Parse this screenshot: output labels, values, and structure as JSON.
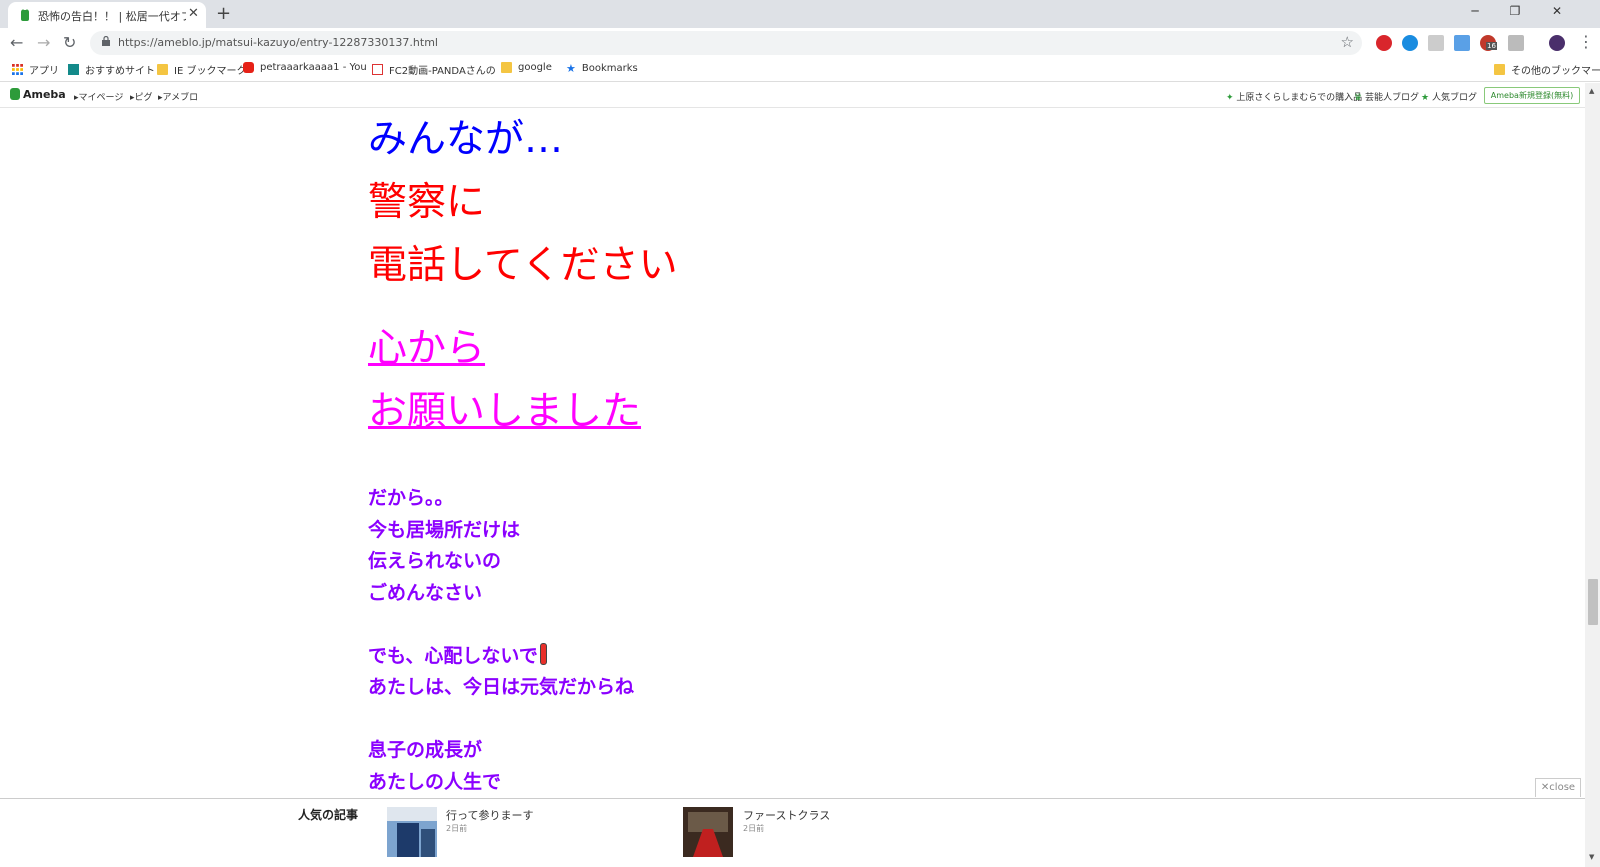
{
  "browser": {
    "tab_title": "恐怖の告白！！ | 松居一代オフィシャ",
    "tab_close": "✕",
    "new_tab": "+",
    "minimize": "─",
    "restore": "❐",
    "close": "✕",
    "url": "https://ameblo.jp/matsui-kazuyo/entry-12287330137.html",
    "ext_badge": "16"
  },
  "bookmarks": {
    "items": [
      {
        "label": "アプリ",
        "icon": "apps-grid-icon"
      },
      {
        "label": "おすすめサイト",
        "icon": "bing-icon"
      },
      {
        "label": "IE ブックマーク",
        "icon": "folder-icon"
      },
      {
        "label": "petraaarkaaaa1 - You",
        "icon": "youtube-icon"
      },
      {
        "label": "FC2動画-PANDAさんの",
        "icon": "fc2-icon"
      },
      {
        "label": "google",
        "icon": "folder-icon"
      },
      {
        "label": "Bookmarks",
        "icon": "star-icon"
      }
    ],
    "other": "その他のブックマーク"
  },
  "ameba": {
    "logo": "Ameba",
    "links": [
      "マイページ",
      "ピグ",
      "アメブロ"
    ],
    "right_links": [
      "上原さくらしまむらでの購入品",
      "芸能人ブログ",
      "人気ブログ"
    ],
    "signup": "Ameba新規登録(無料)"
  },
  "post": {
    "line1": "みんなが…",
    "line2": "警察に",
    "line3": "電話してください",
    "line4": "心から",
    "line5": "お願いしました",
    "p1": [
      "だから。。",
      "今も居場所だけは",
      "伝えられないの",
      "ごめんなさい"
    ],
    "p2a": "でも、心配しないで",
    "p2b": "あたしは、今日は元気だからね",
    "p3": [
      "息子の成長が",
      "あたしの人生で"
    ]
  },
  "popular": {
    "title": "人気の記事",
    "items": [
      {
        "title": "行って参りまーす",
        "date": "2日前"
      },
      {
        "title": "ファーストクラス",
        "date": "2日前"
      }
    ],
    "close": "✕close"
  },
  "colors": {
    "blue": "#0000ff",
    "red": "#ff0000",
    "pink": "#ff00ff",
    "purple": "#8b00ff"
  }
}
